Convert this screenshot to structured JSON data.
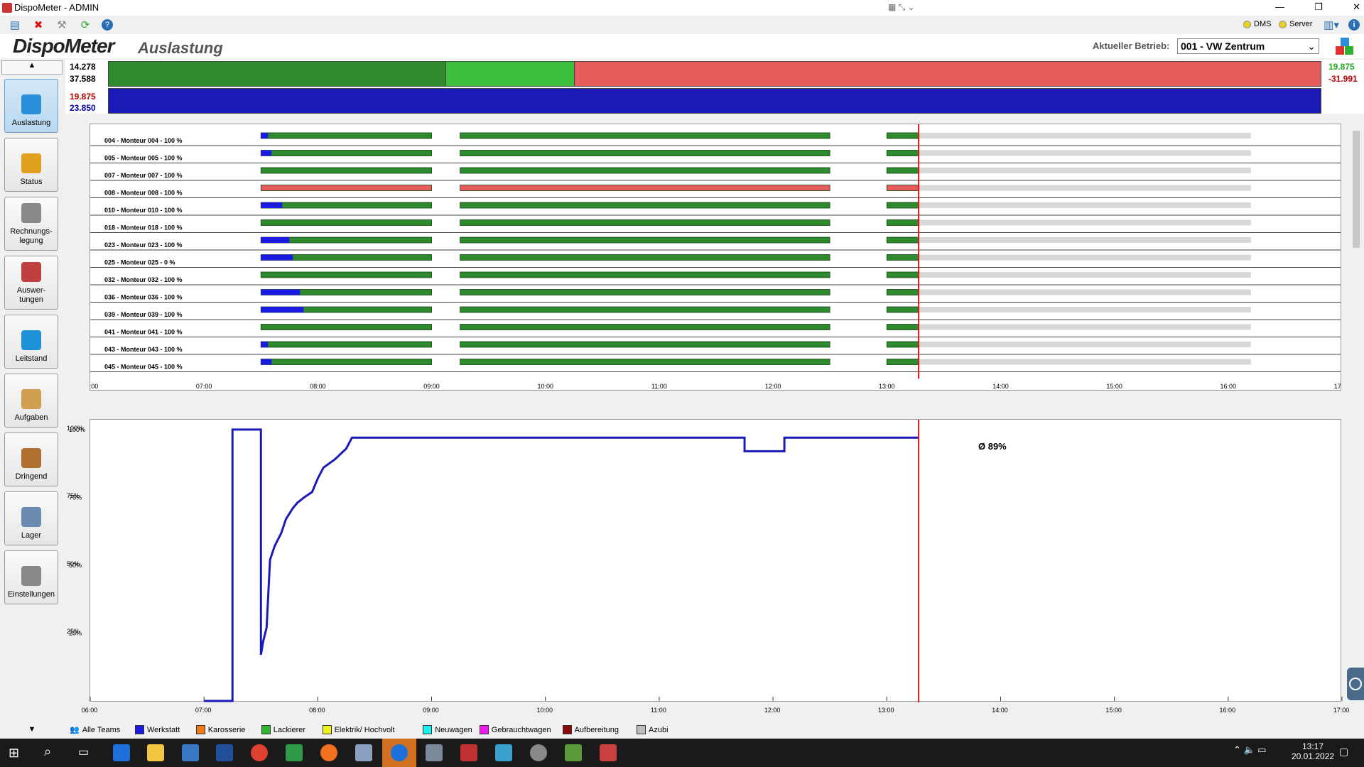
{
  "window": {
    "title": "DispoMeter - ADMIN",
    "controls": [
      "—",
      "❐",
      "✕"
    ]
  },
  "toolbar": {
    "dms_label": "DMS",
    "server_label": "Server",
    "status_color": "#e6d020"
  },
  "header": {
    "logo_main": "Dispo",
    "logo_accent": "Meter",
    "page_title": "Auslastung",
    "betrieb_label": "Aktueller Betrieb:",
    "betrieb_value": "001 - VW Zentrum"
  },
  "sidebar": {
    "items": [
      {
        "label": "Auslastung",
        "icon": "cubes-icon",
        "active": true
      },
      {
        "label": "Status",
        "icon": "clipboard-icon",
        "active": false
      },
      {
        "label": "Rechnungs-\nlegung",
        "icon": "calculator-icon",
        "active": false
      },
      {
        "label": "Auswer-\ntungen",
        "icon": "chart-icon",
        "active": false
      },
      {
        "label": "Leitstand",
        "icon": "monitor-icon",
        "active": false
      },
      {
        "label": "Aufgaben",
        "icon": "notepad-icon",
        "active": false
      },
      {
        "label": "Dringend",
        "icon": "alarm-icon",
        "active": false
      },
      {
        "label": "Lager",
        "icon": "basket-icon",
        "active": false
      },
      {
        "label": "Einstellungen",
        "icon": "gear-icon",
        "active": false
      }
    ]
  },
  "summary": {
    "left_top": "14.278",
    "left_mid": "37.588",
    "left_b1": "19.875",
    "left_b2": "23.850",
    "right_top": "19.875",
    "right_mid": "-31.991",
    "bar1_segments": [
      {
        "fraction": 0.278,
        "color": "#2d8a2d"
      },
      {
        "fraction": 0.106,
        "color": "#3cbf3c"
      },
      {
        "fraction": 0.616,
        "color": "#e65c5c"
      }
    ],
    "bar2_color": "#1a1ab8"
  },
  "time_axis": [
    "06:00",
    "07:00",
    "08:00",
    "09:00",
    "10:00",
    "11:00",
    "12:00",
    "13:00",
    "14:00",
    "15:00",
    "16:00",
    "17:00"
  ],
  "gantt": {
    "rows": [
      {
        "label": "004 - Monteur 004 - 100 %"
      },
      {
        "label": "005 - Monteur 005 - 100 %"
      },
      {
        "label": "007 - Monteur 007 - 100 %"
      },
      {
        "label": "008 - Monteur 008 - 100 %"
      },
      {
        "label": "010 - Monteur 010 - 100 %"
      },
      {
        "label": "018 - Monteur 018 - 100 %"
      },
      {
        "label": "023 - Monteur 023 - 100 %"
      },
      {
        "label": "025 - Monteur 025 - 0 %"
      },
      {
        "label": "032 - Monteur 032 - 100 %"
      },
      {
        "label": "036 - Monteur 036 - 100 %"
      },
      {
        "label": "039 - Monteur 039 - 100 %"
      },
      {
        "label": "041 - Monteur 041 - 100 %"
      },
      {
        "label": "043 - Monteur 043 - 100 %"
      },
      {
        "label": "045 - Monteur 045 - 100 %"
      }
    ],
    "current_time": 13.28
  },
  "chart_data": {
    "type": "line",
    "y_ticks": [
      "100%",
      "75%",
      "50%",
      "25%"
    ],
    "ylim": [
      0,
      100
    ],
    "x_ticks": [
      "06:00",
      "07:00",
      "08:00",
      "09:00",
      "10:00",
      "11:00",
      "12:00",
      "13:00",
      "14:00",
      "15:00",
      "16:00",
      "17:00"
    ],
    "average_label": "Ø 89%",
    "series": [
      {
        "color": "#1a1ab8",
        "points": [
          [
            7.0,
            0
          ],
          [
            7.25,
            0
          ],
          [
            7.25,
            100
          ],
          [
            7.5,
            100
          ],
          [
            7.5,
            17
          ],
          [
            7.52,
            22
          ],
          [
            7.55,
            27
          ],
          [
            7.58,
            52
          ],
          [
            7.62,
            57
          ],
          [
            7.68,
            62
          ],
          [
            7.72,
            67
          ],
          [
            7.78,
            71
          ],
          [
            7.82,
            73
          ],
          [
            7.88,
            75
          ],
          [
            7.95,
            77
          ],
          [
            8.0,
            82
          ],
          [
            8.05,
            86
          ],
          [
            8.15,
            89
          ],
          [
            8.25,
            93
          ],
          [
            8.3,
            97
          ],
          [
            9.7,
            97
          ],
          [
            11.75,
            97
          ],
          [
            11.75,
            92
          ],
          [
            12.1,
            92
          ],
          [
            12.1,
            97
          ],
          [
            13.28,
            97
          ]
        ]
      }
    ]
  },
  "legend": [
    {
      "label": "Alle Teams",
      "color": ""
    },
    {
      "label": "Werkstatt",
      "color": "#1a1ae0"
    },
    {
      "label": "Karosserie",
      "color": "#f07a1a"
    },
    {
      "label": "Lackierer",
      "color": "#2db82d"
    },
    {
      "label": "Elektrik/ Hochvolt",
      "color": "#f0f01a"
    },
    {
      "label": "Neuwagen",
      "color": "#1af0f0"
    },
    {
      "label": "Gebrauchtwagen",
      "color": "#f01af0"
    },
    {
      "label": "Aufbereitung",
      "color": "#8a0a0a"
    },
    {
      "label": "Azubi",
      "color": "#bdbdbd"
    }
  ],
  "taskbar": {
    "time": "13:17",
    "date": "20.01.2022"
  }
}
